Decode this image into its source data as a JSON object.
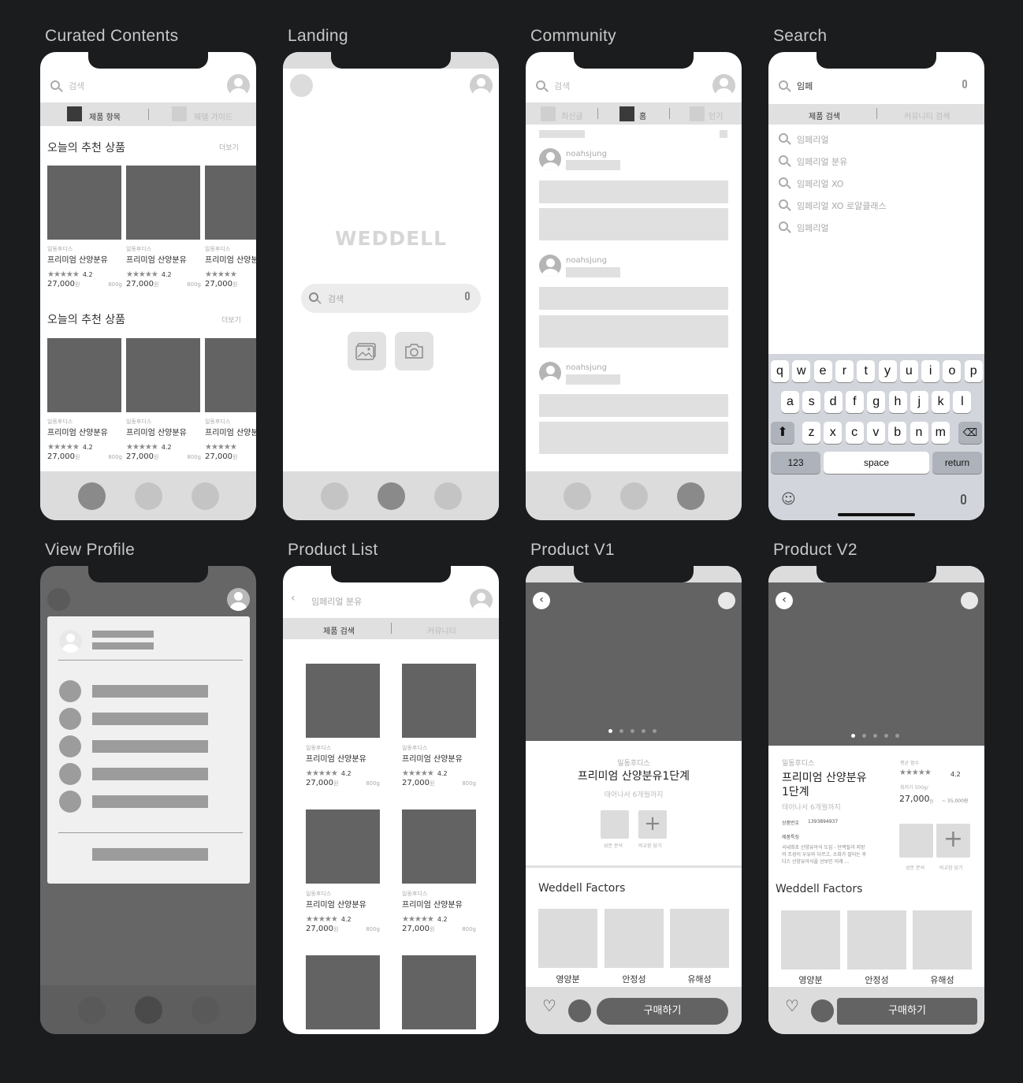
{
  "frames": {
    "curated": "Curated Contents",
    "landing": "Landing",
    "community": "Community",
    "search": "Search",
    "profile": "View Profile",
    "plist": "Product List",
    "pv1": "Product V1",
    "pv2": "Product V2"
  },
  "curated": {
    "search_placeholder": "검색",
    "tab1": "제품 항목",
    "tab2": "웨델 가이드",
    "section1_title": "오늘의 추천 상품",
    "section2_title": "오늘의 추천 상품",
    "more": "더보기",
    "card": {
      "brand": "일동후디스",
      "name": "프리미엄 산양분유",
      "name_cut": "프리미엄 산양분",
      "stars": "★★★★★",
      "rating": "4.2",
      "price": "27,000",
      "won": "원",
      "weight": "800g"
    }
  },
  "landing": {
    "logo": "WEDDELL",
    "search_placeholder": "검색",
    "gallery_icon": "image-icon",
    "camera_icon": "camera-icon"
  },
  "community": {
    "search_placeholder": "검색",
    "tab1": "최신글",
    "tab2": "홈",
    "tab3": "인기",
    "username": "noahsjung"
  },
  "search": {
    "query": "임페",
    "tab1": "제품 검색",
    "tab2": "커뮤니티 검색",
    "suggestions": [
      "임페리얼",
      "임페리얼 분유",
      "임페리얼 XO",
      "임페리얼 XO 로얄클래스",
      "임페리얼"
    ],
    "row1": [
      "q",
      "w",
      "e",
      "r",
      "t",
      "y",
      "u",
      "i",
      "o",
      "p"
    ],
    "row2": [
      "a",
      "s",
      "d",
      "f",
      "g",
      "h",
      "j",
      "k",
      "l"
    ],
    "row3": [
      "z",
      "x",
      "c",
      "v",
      "b",
      "n",
      "m"
    ],
    "k123": "123",
    "space": "space",
    "ret": "return"
  },
  "plist": {
    "title": "임페리얼 분유",
    "tab1": "제품 검색",
    "tab2": "커뮤니티",
    "card": {
      "brand": "일동후디스",
      "name": "프리미엄 산양분유",
      "stars": "★★★★★",
      "rating": "4.2",
      "price": "27,000",
      "won": "원",
      "weight": "800g"
    }
  },
  "pv1": {
    "brand": "일동후디스",
    "name": "프리미엄 산양분유1단계",
    "age": "태어나서 6개월까지",
    "btn1": "성분 분석",
    "btn2": "비교함 담기",
    "factors_title": "Weddell Factors",
    "f1": "영양분",
    "f2": "안정성",
    "f3": "유해성",
    "buy": "구매하기"
  },
  "pv2": {
    "brand": "일동후디스",
    "name1": "프리미엄 산양분유",
    "name2": "1단계",
    "age": "태어나서 6개월까지",
    "rating_label": "평균 점수",
    "stars": "★★★★★",
    "rating": "4.2",
    "lowest": "최저가 500g/",
    "price": "27,000",
    "won": "원",
    "price_max": "~ 35,000원",
    "code_label": "상품번호",
    "code": "1393894937",
    "feature_label": "제품특징",
    "desc1": "국내최초 산양유아식 도입 - 단백질과 지방",
    "desc2": "의 조성이 우유와 다르고, 소화가 잘되는 후",
    "desc3": "디스 산양유아식을 선보인 이래 ...",
    "btn1": "성분 분석",
    "btn2": "비교함 담기",
    "factors_title": "Weddell Factors",
    "f1": "영양분",
    "f2": "안정성",
    "f3": "유해성",
    "buy": "구매하기"
  },
  "colors": {
    "background": "#1b1c1e",
    "dark": "#636363",
    "accent": "#3a3a3a"
  }
}
